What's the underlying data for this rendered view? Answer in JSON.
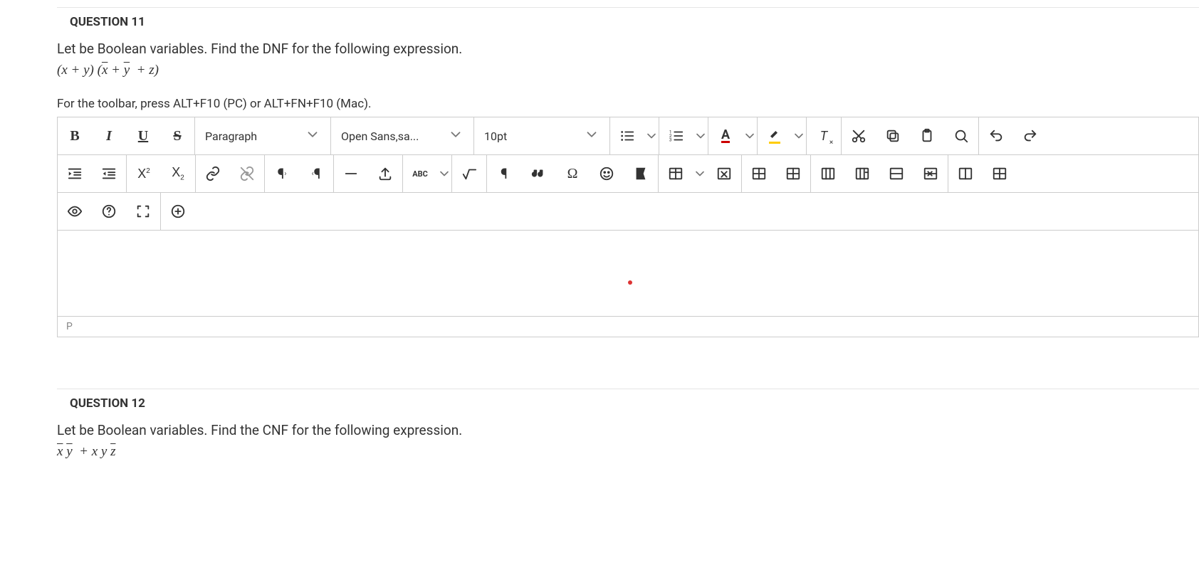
{
  "question11": {
    "header": "QUESTION 11",
    "prompt": "Let  be Boolean variables. Find the DNF for the following expression.",
    "helper": "For the toolbar, press ALT+F10 (PC) or ALT+FN+F10 (Mac).",
    "status": "P"
  },
  "toolbar": {
    "format_select": "Paragraph",
    "font_select": "Open Sans,sa...",
    "size_select": "10pt"
  },
  "question12": {
    "header": "QUESTION 12",
    "prompt": "Let  be Boolean variables. Find the CNF for the following expression."
  }
}
